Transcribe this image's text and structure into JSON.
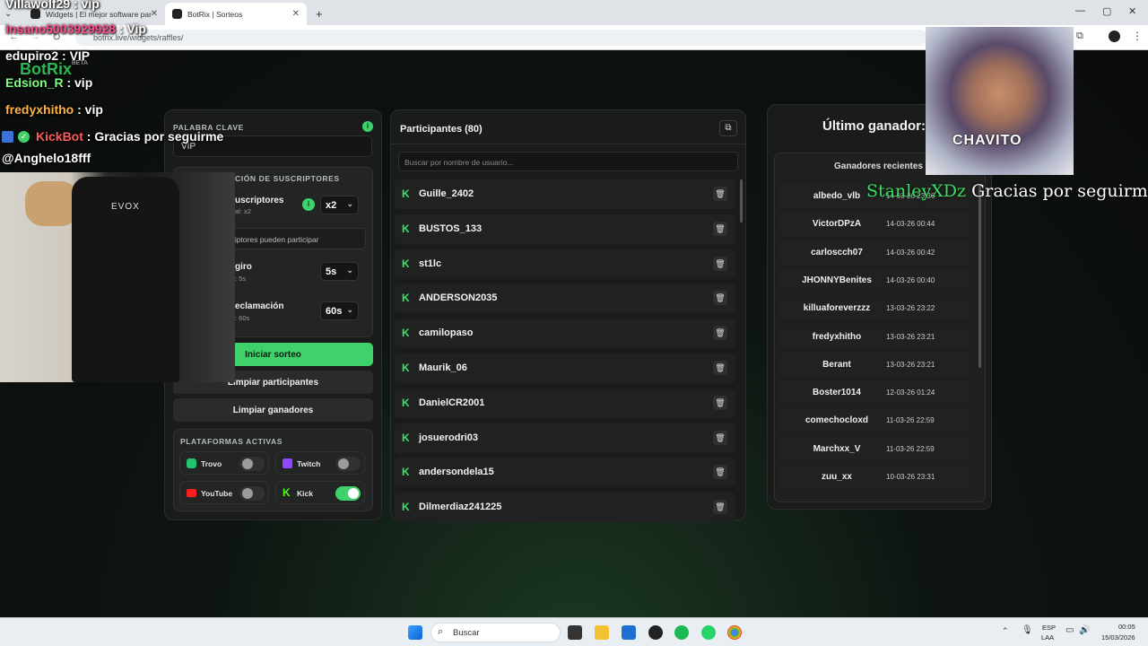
{
  "browser": {
    "tabs": [
      {
        "label": "Widgets | El mejor software par"
      },
      {
        "label": "BotRix | Sorteos"
      }
    ],
    "url": "botrix.live/widgets/raffles/",
    "new_tab": "+"
  },
  "sidebar": {
    "keyword_label": "PALABRA CLAVE",
    "keyword_value": "VIP",
    "subs_section": "CIÓN DE SUSCRIPTORES",
    "subs_title": "uscriptores",
    "subs_sub": "al: x2",
    "multiplier": "x2",
    "subs_only": "riptores pueden participar",
    "spin_title": "giro",
    "spin_sub": ": 5s",
    "spin_value": "5s",
    "claim_title": "eclamación",
    "claim_sub": ": 60s",
    "claim_value": "60s",
    "start_btn": "Iniciar sorteo",
    "clear_participants_btn": "Limpiar participantes",
    "clear_winners_btn": "Limpiar ganadores",
    "platforms_label": "PLATAFORMAS ACTIVAS",
    "platforms": [
      {
        "name": "Trovo",
        "on": false
      },
      {
        "name": "Twitch",
        "on": false
      },
      {
        "name": "YouTube",
        "on": false
      },
      {
        "name": "Kick",
        "on": true
      }
    ]
  },
  "participants": {
    "title": "Participantes (80)",
    "search_placeholder": "Buscar por nombre de usuario...",
    "list": [
      "Guille_2402",
      "BUSTOS_133",
      "st1lc",
      "ANDERSON2035",
      "camilopaso",
      "Maurik_06",
      "DanielCR2001",
      "josuerodri03",
      "andersondela15",
      "Dilmerdiaz241225"
    ]
  },
  "winners": {
    "title": "Último ganador:",
    "recent_label": "Ganadores recientes",
    "list": [
      {
        "name": "albedo_vlb",
        "date": "14-03-26 23:36"
      },
      {
        "name": "VictorDPzA",
        "date": "14-03-26 00:44"
      },
      {
        "name": "carloscch07",
        "date": "14-03-26 00:42"
      },
      {
        "name": "JHONNYBenites",
        "date": "14-03-26 00:40"
      },
      {
        "name": "killuaforeverzzz",
        "date": "13-03-26 23:22"
      },
      {
        "name": "fredyxhitho",
        "date": "13-03-26 23:21"
      },
      {
        "name": "Berant",
        "date": "13-03-26 23:21"
      },
      {
        "name": "Boster1014",
        "date": "12-03-26 01:24"
      },
      {
        "name": "comechocloxd",
        "date": "11-03-26 22:59"
      },
      {
        "name": "Marchxx_V",
        "date": "11-03-26 22:59"
      },
      {
        "name": "zuu_xx",
        "date": "10-03-26 23:31"
      }
    ]
  },
  "overlay": {
    "chat": [
      {
        "user": "Villawolf29",
        "msg": " : vip",
        "color": "#ffffff"
      },
      {
        "user": "Insano5003929928",
        "msg": " : Vip",
        "color": "#ff4d8d"
      },
      {
        "user": "edupiro2",
        "msg": " : VIP",
        "color": "#ffffff"
      },
      {
        "user": "Edsion_R",
        "msg": " : vip",
        "color": "#7dff7d"
      },
      {
        "user": "fredyxhitho",
        "msg": " : vip",
        "color": "#ffb347"
      },
      {
        "user": "KickBot",
        "msg": " : Gracias por seguirme",
        "color": "#ff5a5a"
      },
      {
        "user": "@Anghelo18fff",
        "msg": "",
        "color": "#ffffff"
      }
    ],
    "botrix_logo": "BotRix",
    "beta": "BETA",
    "cam_brand": "EVOX",
    "cam_label": "CHAVITO",
    "follow_user": "StanleyXDz",
    "follow_msg": " Gracias por seguirme!!"
  },
  "taskbar": {
    "search": "Buscar",
    "lang1": "ESP",
    "lang2": "LAA",
    "time": "00:05",
    "date": "15/03/2026"
  },
  "colors": {
    "accent": "#3fd26b",
    "kick": "#53fc18",
    "bg": "#0c0f0d"
  }
}
